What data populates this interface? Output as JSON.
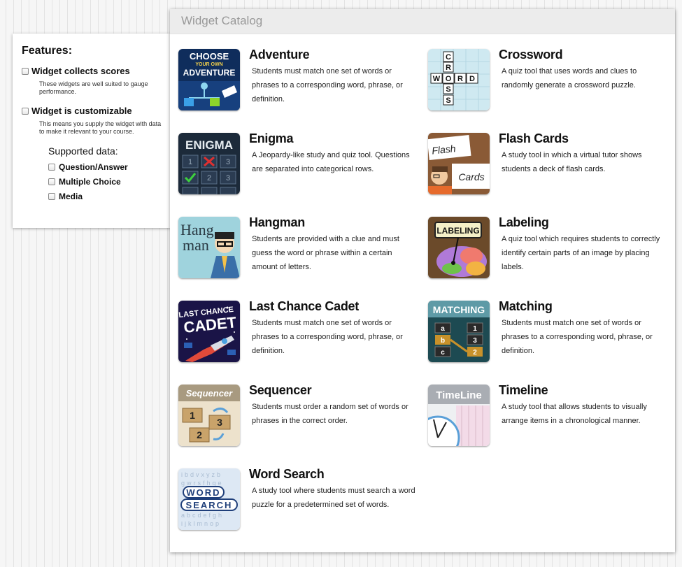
{
  "features": {
    "title": "Features:",
    "items": [
      {
        "label": "Widget collects scores",
        "desc": "These widgets are well suited to gauge performance."
      },
      {
        "label": "Widget is customizable",
        "desc": "This means you supply the widget with data to make it relevant to your course."
      }
    ],
    "supported_title": "Supported data:",
    "supported": [
      "Question/Answer",
      "Multiple Choice",
      "Media"
    ]
  },
  "catalog": {
    "title": "Widget Catalog",
    "widgets": [
      {
        "name": "Adventure",
        "desc": "Students must match one set of words or phrases to a corresponding word, phrase, or definition.",
        "icon": "adventure-icon",
        "icon_text": [
          "CHOOSE",
          "YOUR OWN",
          "ADVENTURE"
        ]
      },
      {
        "name": "Crossword",
        "desc": "A quiz tool that uses words and clues to randomly generate a crossword puzzle.",
        "icon": "crossword-icon",
        "icon_text": [
          "CROSS",
          "WORD"
        ]
      },
      {
        "name": "Enigma",
        "desc": "A Jeopardy-like study and quiz tool. Questions are separated into categorical rows.",
        "icon": "enigma-icon",
        "icon_text": [
          "ENIGMA"
        ]
      },
      {
        "name": "Flash Cards",
        "desc": "A study tool in which a virtual tutor shows students a deck of flash cards.",
        "icon": "flash-cards-icon",
        "icon_text": [
          "Flash",
          "Cards"
        ]
      },
      {
        "name": "Hangman",
        "desc": "Students are provided with a clue and must guess the word or phrase within a certain amount of letters.",
        "icon": "hangman-icon",
        "icon_text": [
          "Hang",
          "man"
        ]
      },
      {
        "name": "Labeling",
        "desc": "A quiz tool which requires students to correctly identify certain parts of an image by placing labels.",
        "icon": "labeling-icon",
        "icon_text": [
          "LABELING"
        ]
      },
      {
        "name": "Last Chance Cadet",
        "desc": "Students must match one set of words or phrases to a corresponding word, phrase, or definition.",
        "icon": "last-chance-cadet-icon",
        "icon_text": [
          "LAST CHANCE",
          "CADET"
        ]
      },
      {
        "name": "Matching",
        "desc": "Students must match one set of words or phrases to a corresponding word, phrase, or definition.",
        "icon": "matching-icon",
        "icon_text": [
          "MATCHING"
        ]
      },
      {
        "name": "Sequencer",
        "desc": "Students must order a random set of words or phrases in the correct order.",
        "icon": "sequencer-icon",
        "icon_text": [
          "Sequencer"
        ]
      },
      {
        "name": "Timeline",
        "desc": "A study tool that allows students to visually arrange items in a chronological manner.",
        "icon": "timeline-icon",
        "icon_text": [
          "TimeLine"
        ]
      },
      {
        "name": "Word Search",
        "desc": "A study tool where students must search a word puzzle for a predetermined set of words.",
        "icon": "word-search-icon",
        "icon_text": [
          "WORD",
          "SEARCH"
        ]
      }
    ]
  }
}
